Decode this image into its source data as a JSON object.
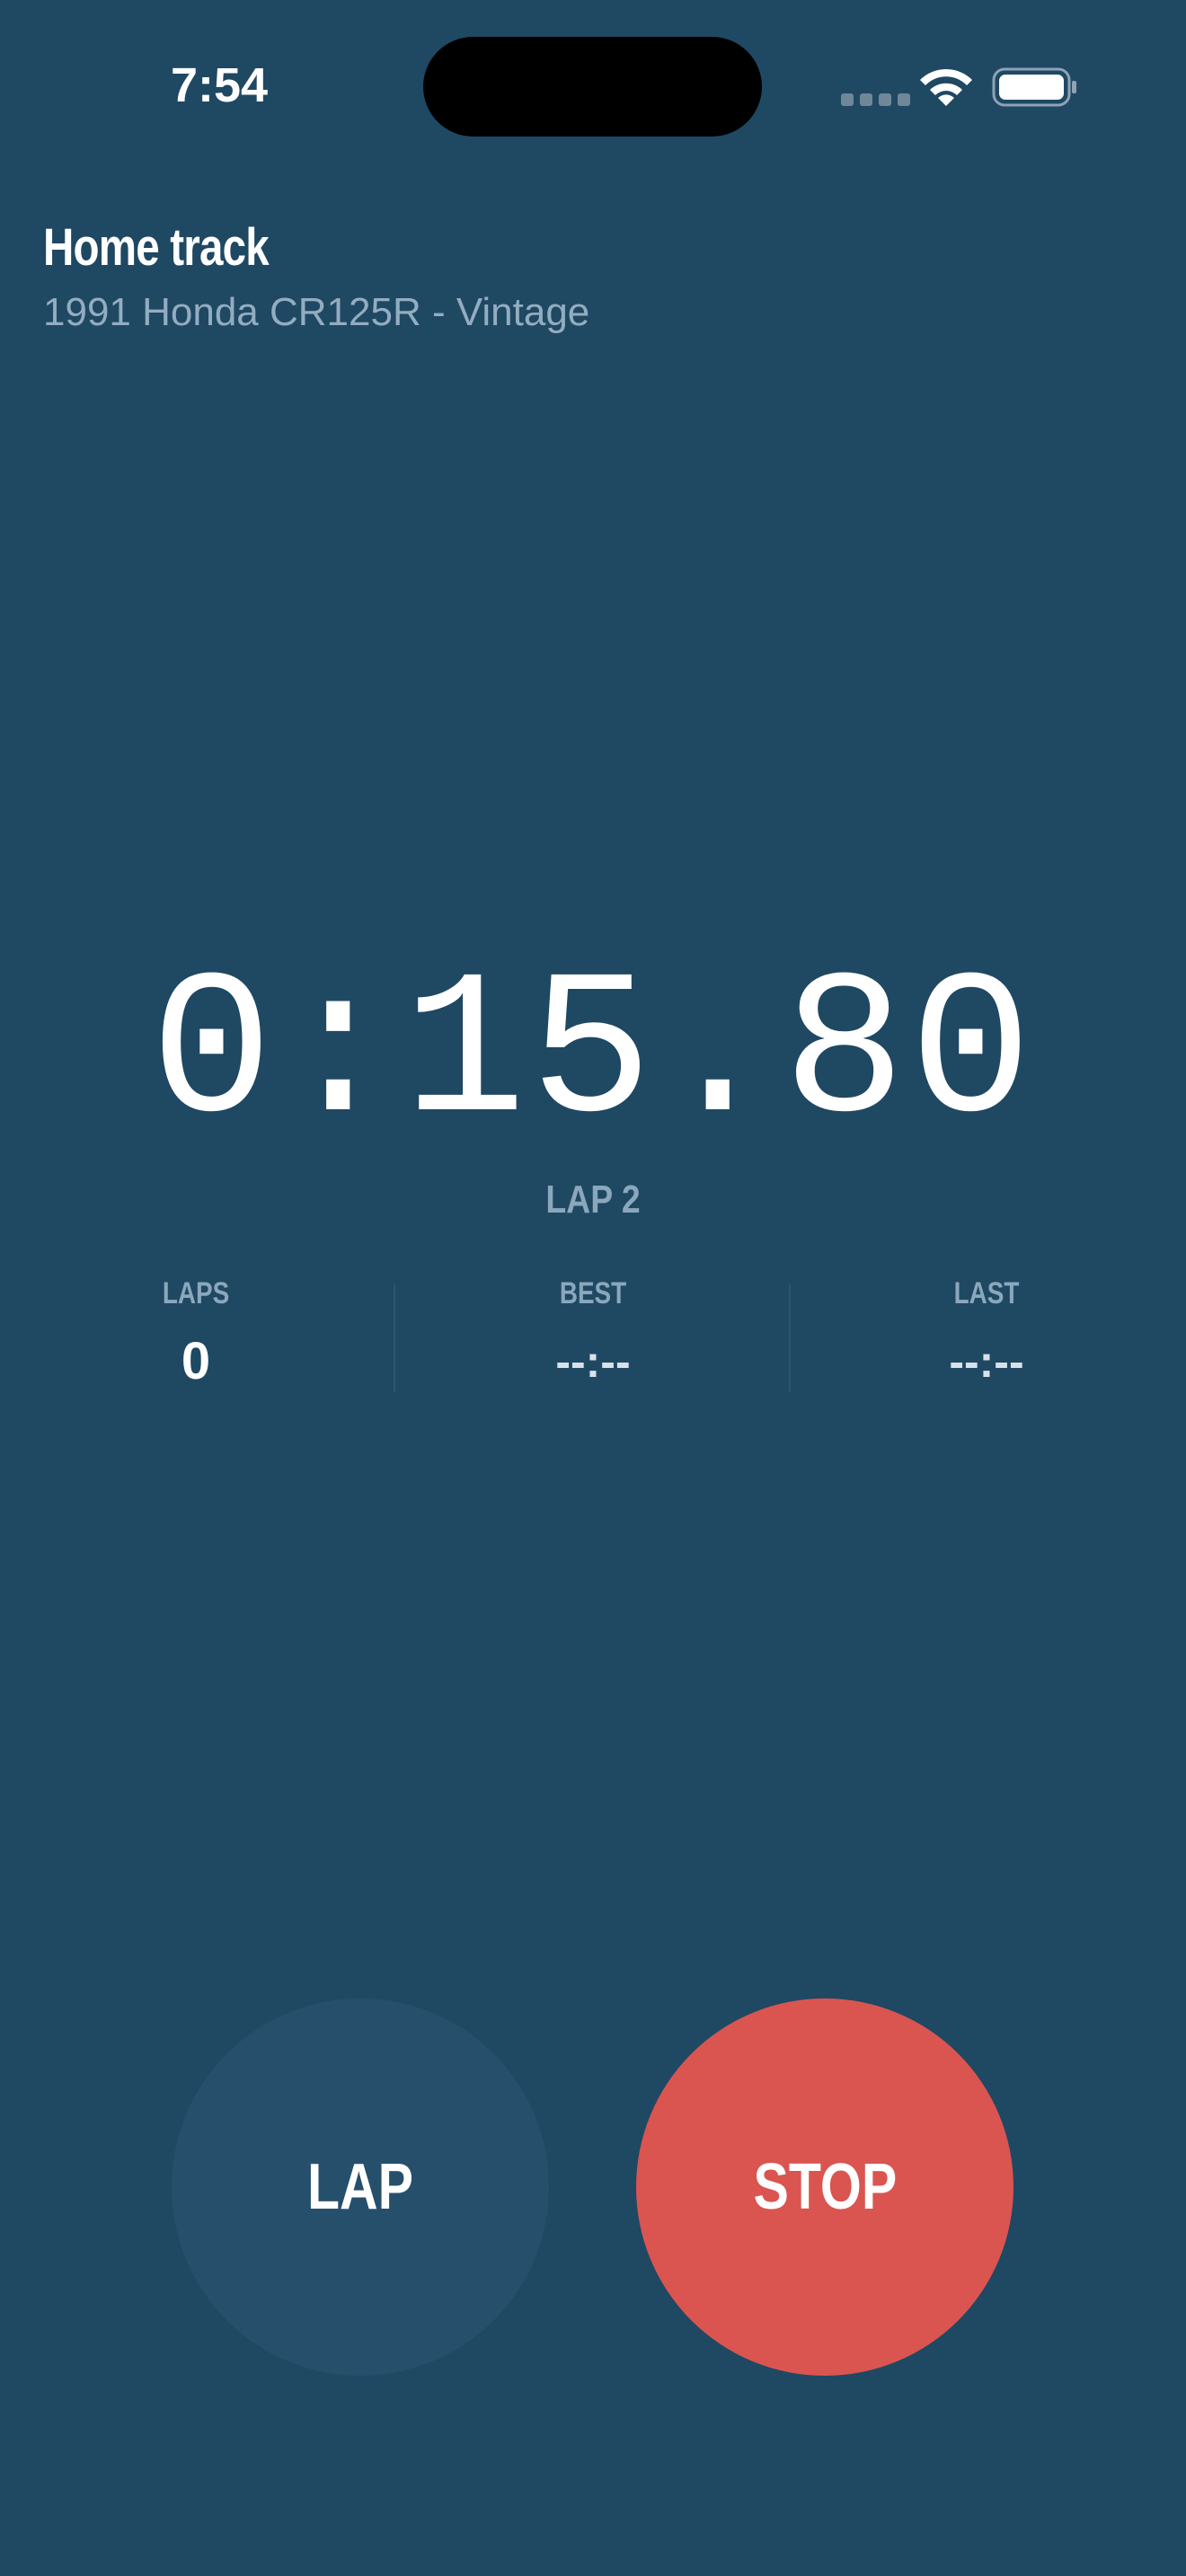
{
  "status_bar": {
    "time": "7:54",
    "icons": [
      "signal-dots-icon",
      "wifi-icon",
      "battery-icon"
    ]
  },
  "header": {
    "title": "Home track",
    "subtitle": "1991 Honda CR125R - Vintage"
  },
  "timer": {
    "display": "0:15.80",
    "lap_label": "LAP 2"
  },
  "stats": {
    "laps": {
      "label": "LAPS",
      "value": "0"
    },
    "best": {
      "label": "BEST",
      "value": "--:--"
    },
    "last": {
      "label": "LAST",
      "value": "--:--"
    }
  },
  "controls": {
    "lap_label": "LAP",
    "stop_label": "STOP"
  },
  "colors": {
    "background": "#1f4863",
    "lap_button": "#264f6c",
    "stop_button": "#da5550",
    "muted_text": "#8aa7bc"
  }
}
